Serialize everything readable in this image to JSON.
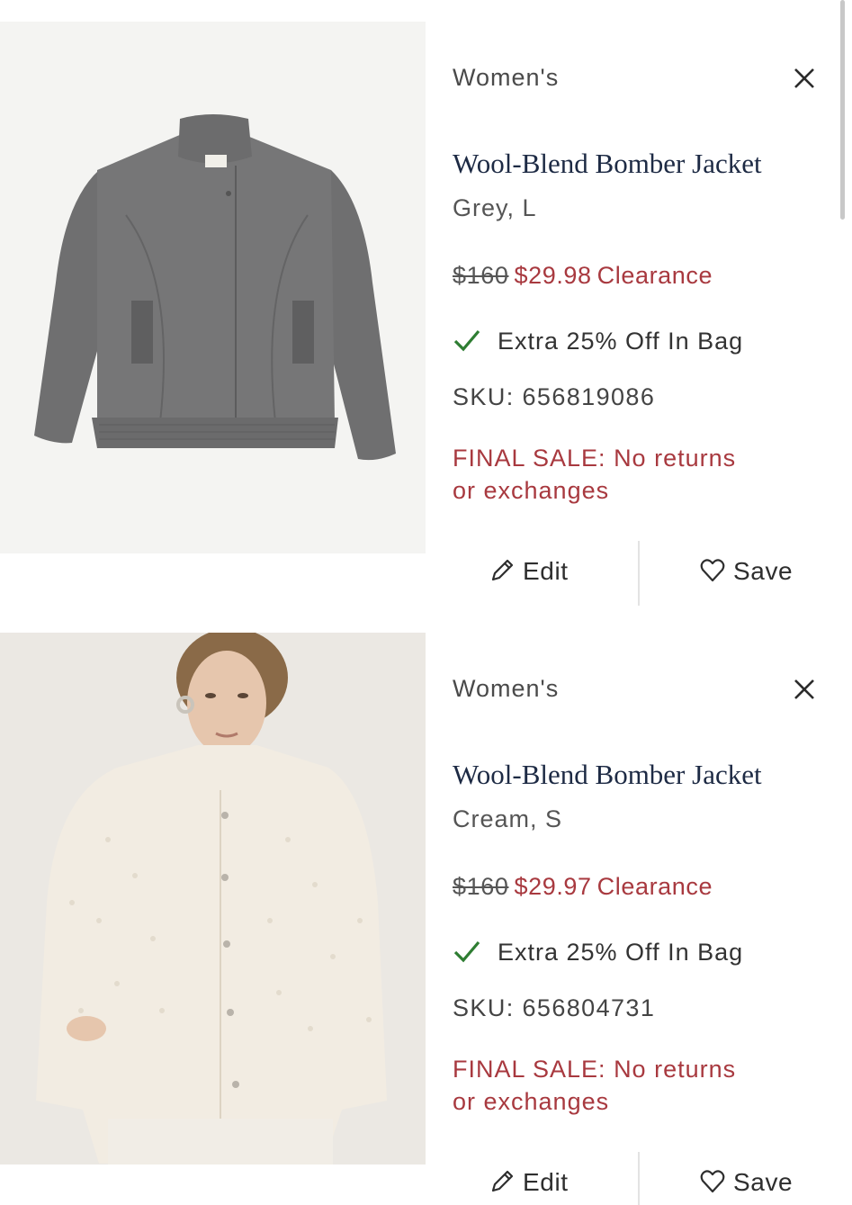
{
  "cart_items": [
    {
      "category": "Women's",
      "title": "Wool-Blend Bomber Jacket",
      "variant": "Grey, L",
      "original_price": "$160",
      "sale_price": "$29.98",
      "price_label": "Clearance",
      "promo": "Extra 25% Off In Bag",
      "sku": "SKU: 656819086",
      "final_sale": "FINAL SALE: No returns or exchanges",
      "edit_label": "Edit",
      "save_label": "Save",
      "image_alt": "grey wool-blend bomber jacket"
    },
    {
      "category": "Women's",
      "title": "Wool-Blend Bomber Jacket",
      "variant": "Cream, S",
      "original_price": "$160",
      "sale_price": "$29.97",
      "price_label": "Clearance",
      "promo": "Extra 25% Off In Bag",
      "sku": "SKU: 656804731",
      "final_sale": "FINAL SALE: No returns or exchanges",
      "edit_label": "Edit",
      "save_label": "Save",
      "image_alt": "cream wool-blend bomber jacket worn by model"
    }
  ],
  "colors": {
    "sale_red": "#a8393f",
    "title_navy": "#1d2a44",
    "check_green": "#2e7d32"
  },
  "icons": {
    "close": "close-icon",
    "check": "check-icon",
    "edit": "pencil-icon",
    "save": "heart-icon"
  }
}
